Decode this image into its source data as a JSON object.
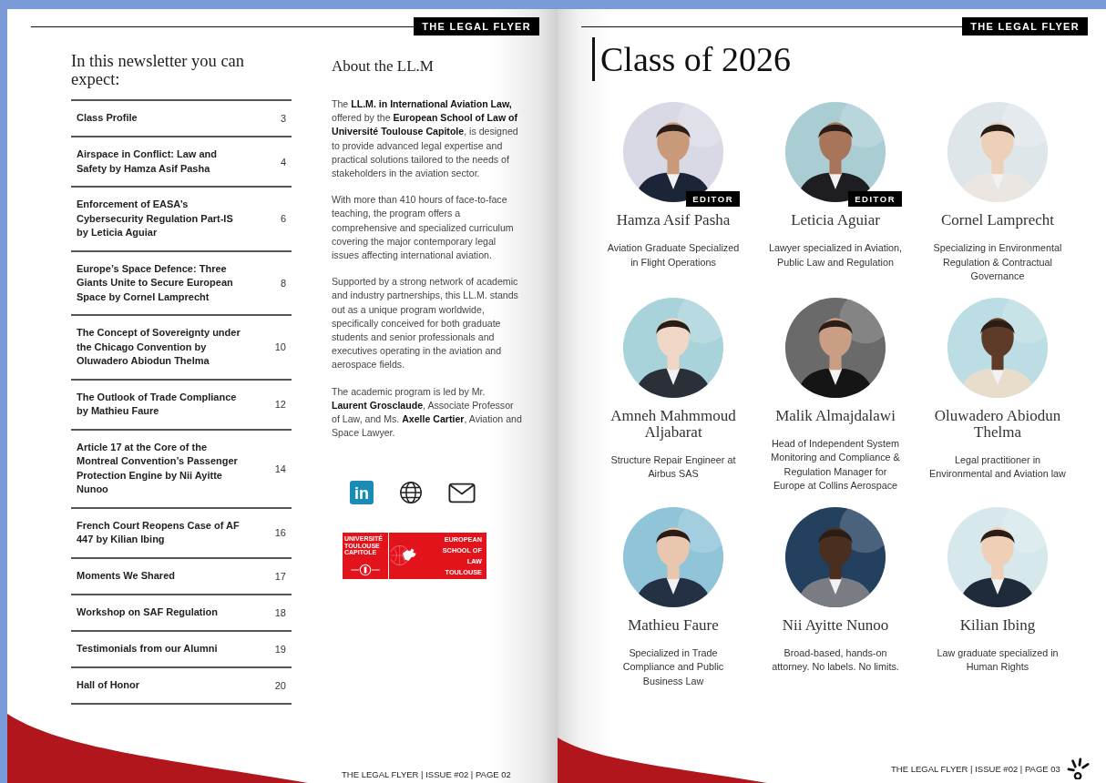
{
  "left_page": {
    "header_tag": "THE LEGAL FLYER",
    "toc": {
      "title": "In this newsletter you can expect:",
      "items": [
        {
          "title": "Class Profile",
          "page": "3"
        },
        {
          "title": "Airspace in Conflict: Law and Safety by Hamza Asif Pasha",
          "page": "4"
        },
        {
          "title": "Enforcement of EASA’s Cybersecurity Regulation Part-IS by Leticia Aguiar",
          "page": "6"
        },
        {
          "title": "Europe’s Space Defence: Three Giants Unite to Secure European Space by Cornel Lamprecht",
          "page": "8"
        },
        {
          "title": "The Concept of Sovereignty under the Chicago Convention by Oluwadero Abiodun Thelma",
          "page": "10"
        },
        {
          "title": "The Outlook of Trade Compliance by Mathieu Faure",
          "page": "12"
        },
        {
          "title": "Article 17 at the Core of the Montreal Convention’s Passenger Protection Engine by Nii Ayitte Nunoo",
          "page": "14"
        },
        {
          "title": "French Court Reopens Case of AF 447 by Kilian Ibing",
          "page": "16"
        },
        {
          "title": "Moments We Shared",
          "page": "17"
        },
        {
          "title": "Workshop on SAF Regulation",
          "page": "18"
        },
        {
          "title": "Testimonials from our Alumni",
          "page": "19"
        },
        {
          "title": "Hall of Honor",
          "page": "20"
        }
      ]
    },
    "about": {
      "title": "About the LL.M",
      "paragraphs": [
        "The **LL.M. in International Aviation Law,** offered by the **European School of Law of Université Toulouse Capitole**, is designed to provide advanced legal expertise and practical solutions tailored to the needs of stakeholders in the aviation sector.",
        "With more than 410 hours of face-to-face teaching, the program offers a comprehensive and specialized curriculum covering the major contemporary legal issues affecting international aviation.",
        "Supported by a strong network of academic and industry partnerships, this LL.M. stands out as a unique program worldwide, specifically conceived for both graduate students and senior professionals and executives operating in the aviation and aerospace fields.",
        "The academic program is led by Mr. **Laurent Grosclaude**, Associate Professor of Law, and Ms. **Axelle Cartier**, Aviation and Space Lawyer."
      ]
    },
    "social": [
      {
        "kind": "linkedin",
        "label": "in"
      },
      {
        "kind": "web"
      },
      {
        "kind": "mail"
      }
    ],
    "logo": {
      "university": "UNIVERSITÉ TOULOUSE CAPITOLE",
      "school": "EUROPEAN SCHOOL OF LAW TOULOUSE"
    },
    "footer": "THE LEGAL FLYER | ISSUE #02 | PAGE 02"
  },
  "right_page": {
    "header_tag": "THE LEGAL FLYER",
    "title": "Class of 2026",
    "people": [
      {
        "name": "Hamza Asif Pasha",
        "role": "Aviation Graduate Specialized in Flight Operations",
        "badge": "EDITOR"
      },
      {
        "name": "Leticia Aguiar",
        "role": "Lawyer specialized in Aviation, Public Law and Regulation",
        "badge": "EDITOR"
      },
      {
        "name": "Cornel Lamprecht",
        "role": "Specializing in Environmental Regulation & Contractual Governance"
      },
      {
        "name": "Amneh Mahmmoud Aljabarat",
        "role": "Structure Repair Engineer at Airbus SAS"
      },
      {
        "name": "Malik Almajdalawi",
        "role": "Head of Independent System Monitoring and Compliance & Regulation Manager for Europe at Collins Aerospace"
      },
      {
        "name": "Oluwadero Abiodun Thelma",
        "role": "Legal practitioner in Environmental and Aviation law"
      },
      {
        "name": "Mathieu Faure",
        "role": "Specialized in Trade Compliance and Public Business Law"
      },
      {
        "name": "Nii Ayitte Nunoo",
        "role": "Broad-based, hands-on attorney. No labels. No limits."
      },
      {
        "name": "Kilian Ibing",
        "role": "Law graduate specialized in Human Rights"
      }
    ],
    "footer": "THE LEGAL FLYER | ISSUE #02 | PAGE 03"
  }
}
